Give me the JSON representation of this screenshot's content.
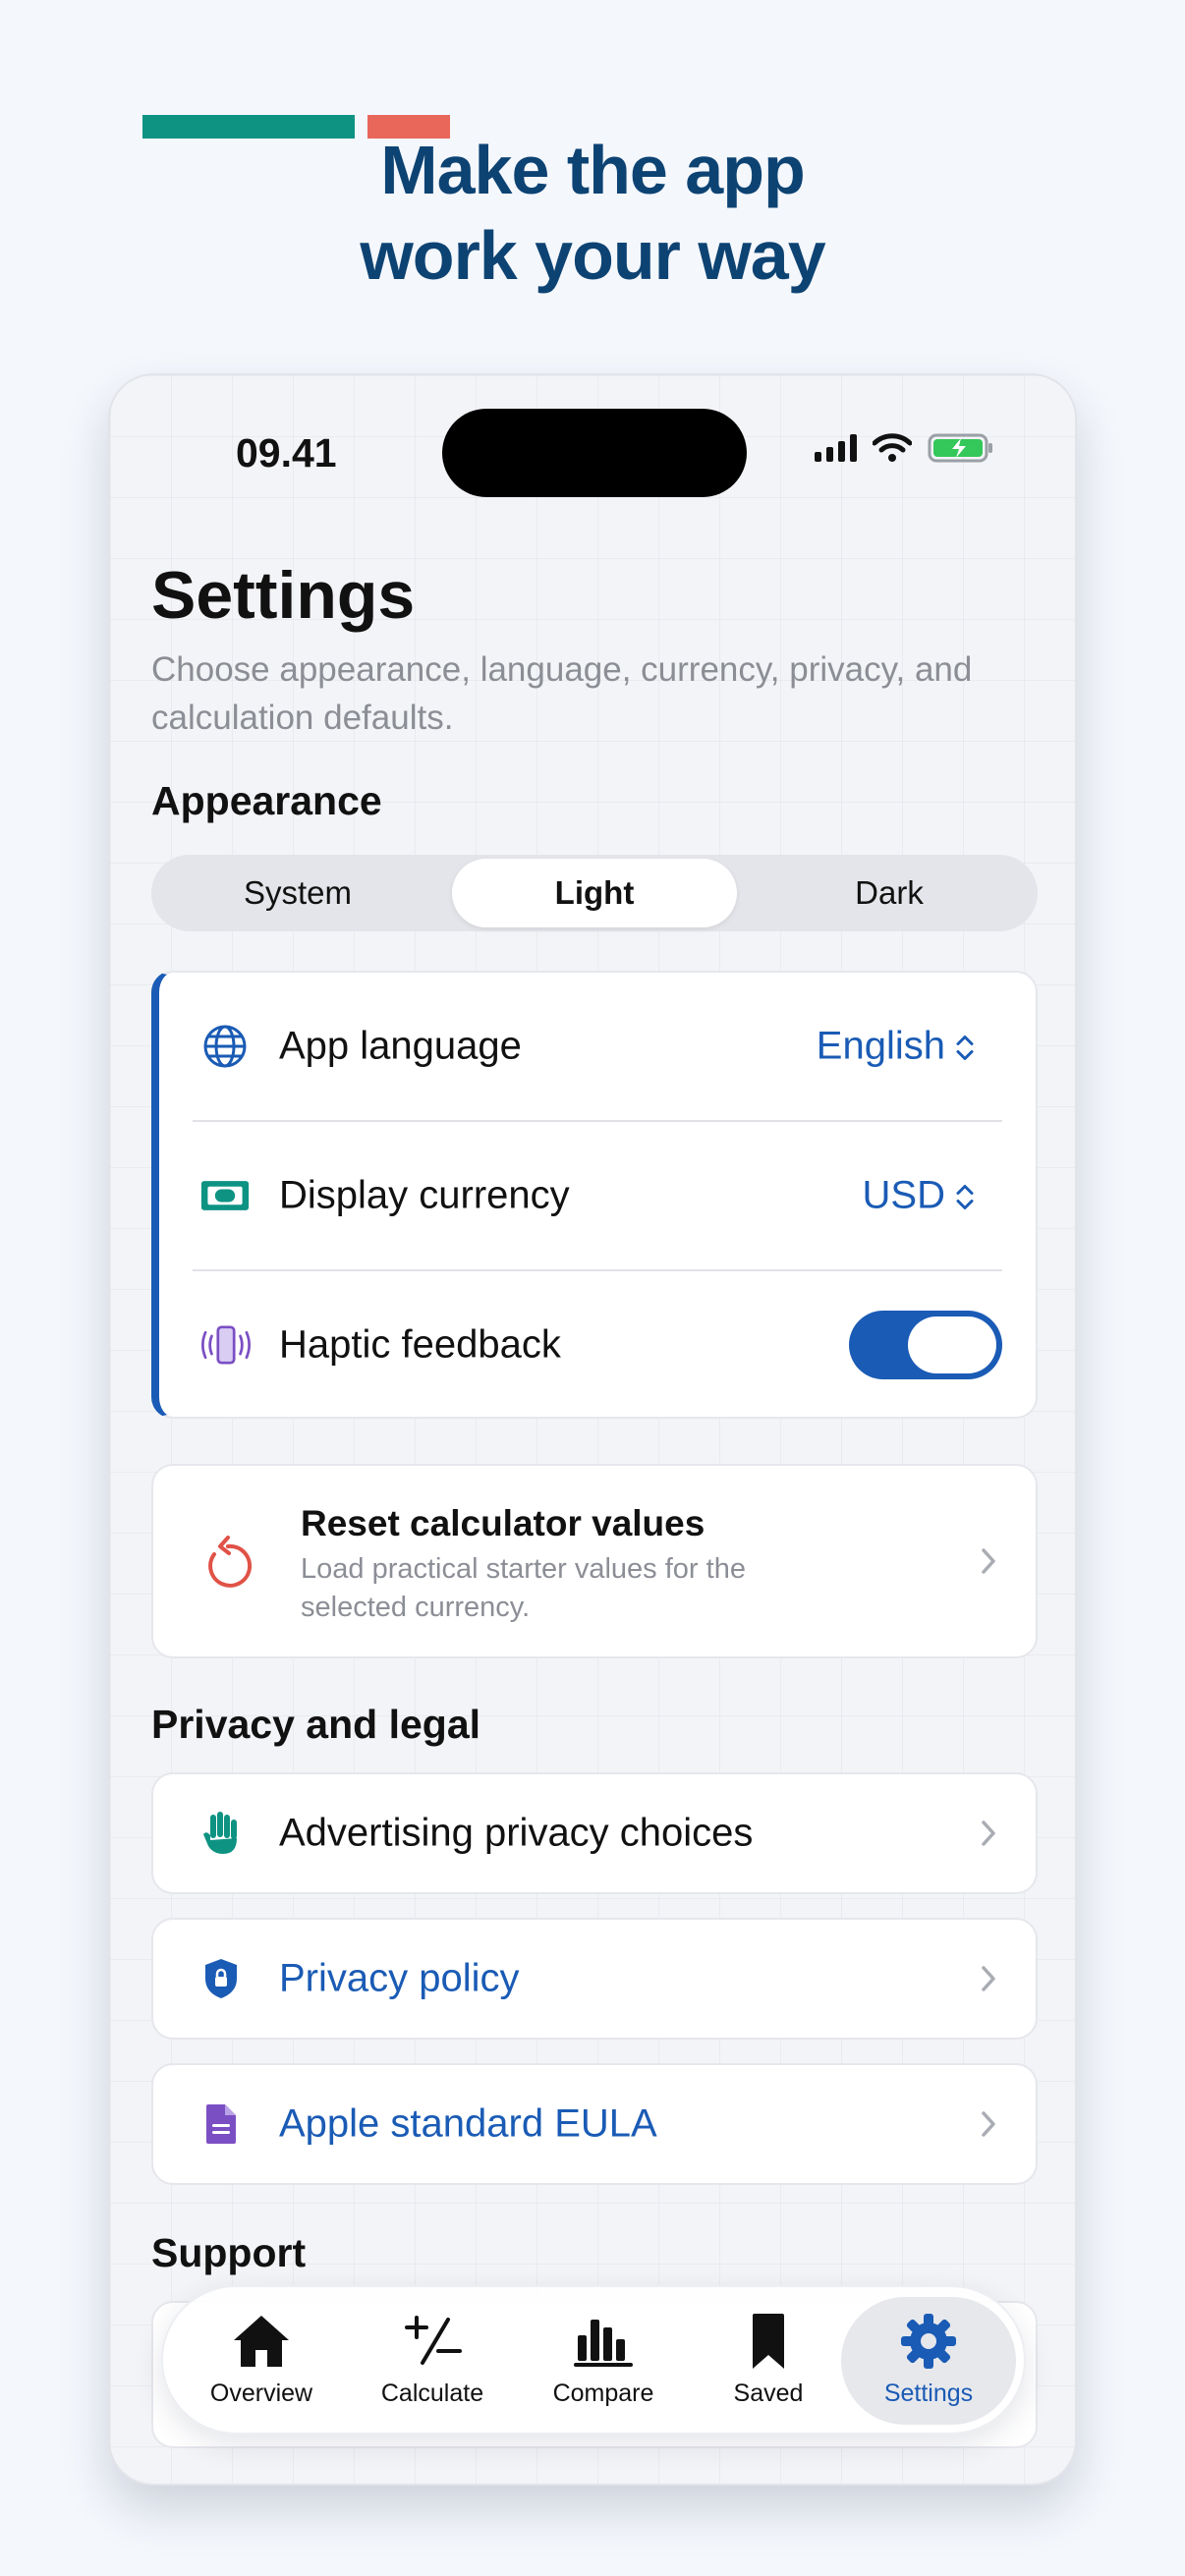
{
  "headline": {
    "line1": "Make the app",
    "line2": "work your way"
  },
  "status": {
    "time": "09.41"
  },
  "page": {
    "title": "Settings",
    "subtitle": "Choose appearance, language, currency, privacy, and calculation defaults."
  },
  "appearance": {
    "label": "Appearance",
    "options": [
      "System",
      "Light",
      "Dark"
    ],
    "selected": "Light"
  },
  "settings": {
    "language": {
      "label": "App language",
      "value": "English"
    },
    "currency": {
      "label": "Display currency",
      "value": "USD"
    },
    "haptics": {
      "label": "Haptic feedback",
      "on": true
    }
  },
  "reset": {
    "title": "Reset calculator values",
    "description": "Load practical starter values for the selected currency."
  },
  "privacy": {
    "label": "Privacy and legal",
    "items": [
      "Advertising privacy choices",
      "Privacy policy",
      "Apple standard EULA"
    ]
  },
  "support": {
    "label": "Support"
  },
  "tabs": [
    "Overview",
    "Calculate",
    "Compare",
    "Saved",
    "Settings"
  ],
  "active_tab": "Settings",
  "colors": {
    "accent": "#1a5bb5",
    "headline": "#0d4373",
    "teal": "#0e9383",
    "coral": "#e9675a"
  }
}
